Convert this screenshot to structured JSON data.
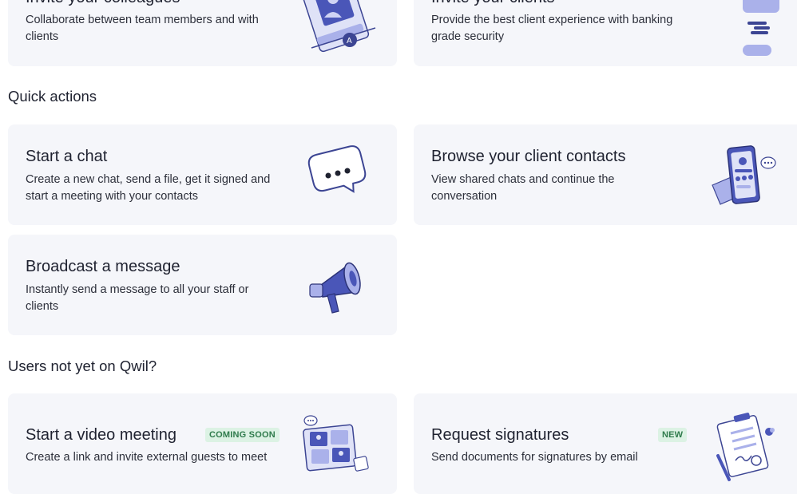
{
  "invite_section": {
    "colleagues": {
      "title": "Invite your colleagues",
      "description": "Collaborate between team members and with clients"
    },
    "clients": {
      "title": "Invite your clients",
      "description": "Provide the best client experience with banking grade security"
    }
  },
  "quick_actions": {
    "heading": "Quick actions",
    "items": [
      {
        "title": "Start a chat",
        "description": "Create a new chat, send a file, get it signed and start a meeting with your contacts",
        "icon": "chat-bubble-icon"
      },
      {
        "title": "Browse your client contacts",
        "description": "View shared chats and continue the conversation",
        "icon": "phone-contacts-icon"
      },
      {
        "title": "Broadcast a message",
        "description": "Instantly send a message to all your staff or clients",
        "icon": "megaphone-icon"
      }
    ]
  },
  "external_users": {
    "heading": "Users not yet on Qwil?",
    "items": [
      {
        "title": "Start a video meeting",
        "badge": "COMING SOON",
        "description": "Create a link and invite external guests to meet",
        "icon": "video-meeting-icon"
      },
      {
        "title": "Request signatures",
        "badge": "NEW",
        "description": "Send documents for signatures by email",
        "icon": "clipboard-signature-icon"
      }
    ]
  },
  "colors": {
    "card_background": "#f5f6fa",
    "illustration_primary": "#4a56b8",
    "illustration_light": "#aab1ea",
    "badge_background": "#dcf2e4",
    "badge_text": "#2f7b4c"
  }
}
